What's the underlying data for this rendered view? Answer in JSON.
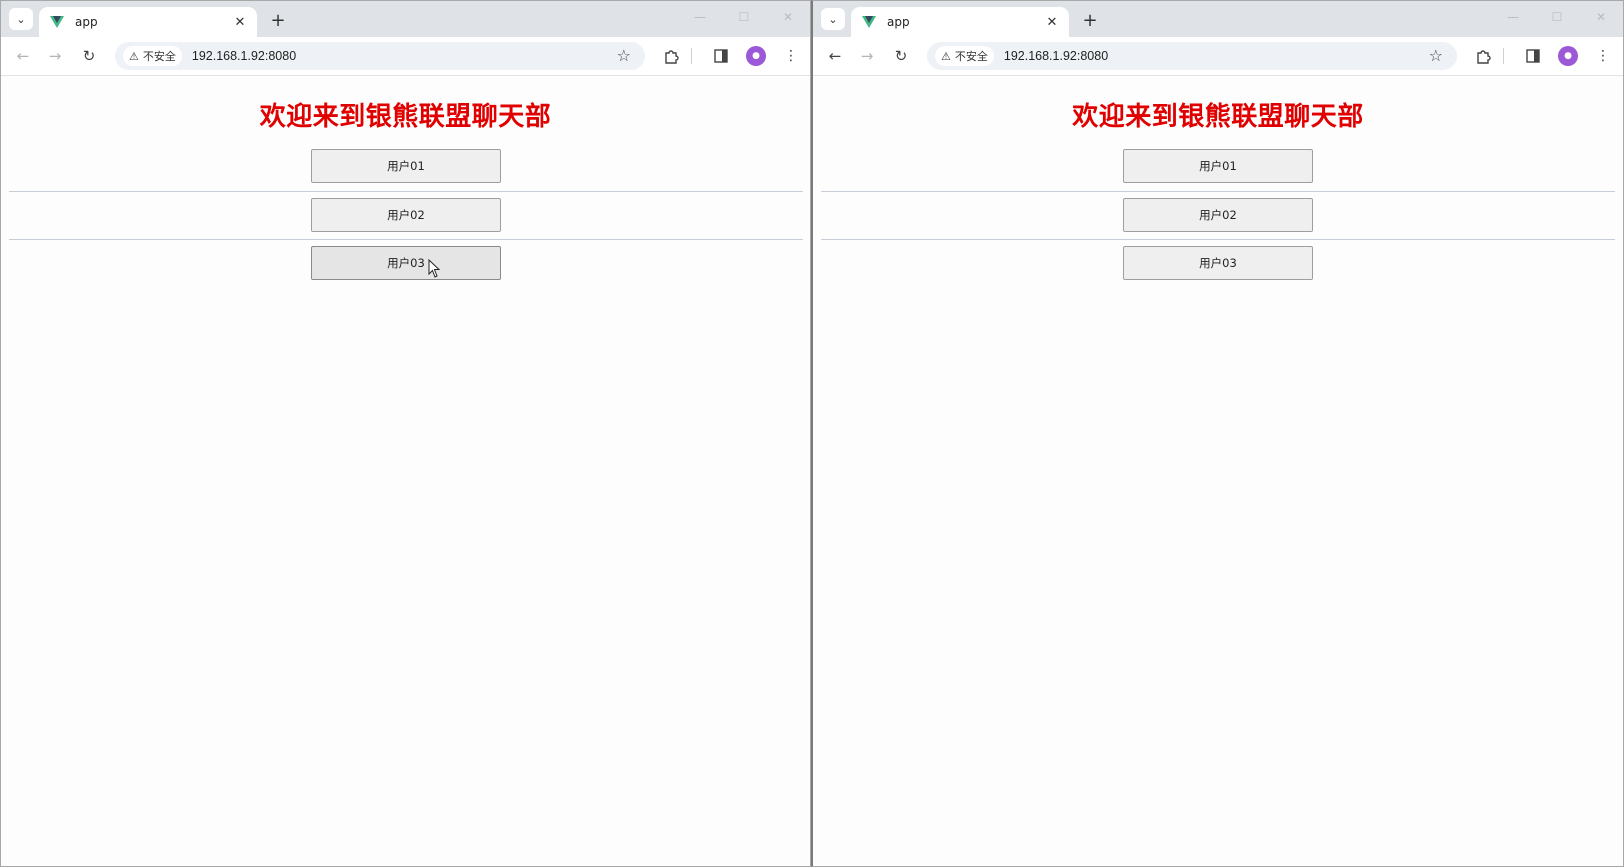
{
  "windows": [
    {
      "tab": {
        "title": "app",
        "close_glyph": "✕"
      },
      "toolbar": {
        "security_label": "不安全",
        "url": "192.168.1.92:8080"
      },
      "page": {
        "title": "欢迎来到银熊联盟聊天部",
        "users": [
          {
            "label": "用户01"
          },
          {
            "label": "用户02"
          },
          {
            "label": "用户03"
          }
        ]
      }
    },
    {
      "tab": {
        "title": "app",
        "close_glyph": "✕"
      },
      "toolbar": {
        "security_label": "不安全",
        "url": "192.168.1.92:8080"
      },
      "page": {
        "title": "欢迎来到银熊联盟聊天部",
        "users": [
          {
            "label": "用户01"
          },
          {
            "label": "用户02"
          },
          {
            "label": "用户03"
          }
        ]
      }
    }
  ],
  "icons": {
    "tab_menu": "chevron-down-icon",
    "favicon": "vue-logo-icon",
    "new_tab": "plus-icon",
    "back": "arrow-left-icon",
    "forward": "arrow-right-icon",
    "reload": "reload-icon",
    "warning": "warning-triangle-icon",
    "bookmark": "star-icon",
    "extensions": "puzzle-icon",
    "side_panel": "side-panel-icon",
    "profile": "avatar-icon",
    "menu": "kebab-menu-icon"
  },
  "colors": {
    "title": "#e00000",
    "favicon_green": "#41b883",
    "favicon_dark": "#34495e",
    "avatar": "#9b59d8"
  }
}
